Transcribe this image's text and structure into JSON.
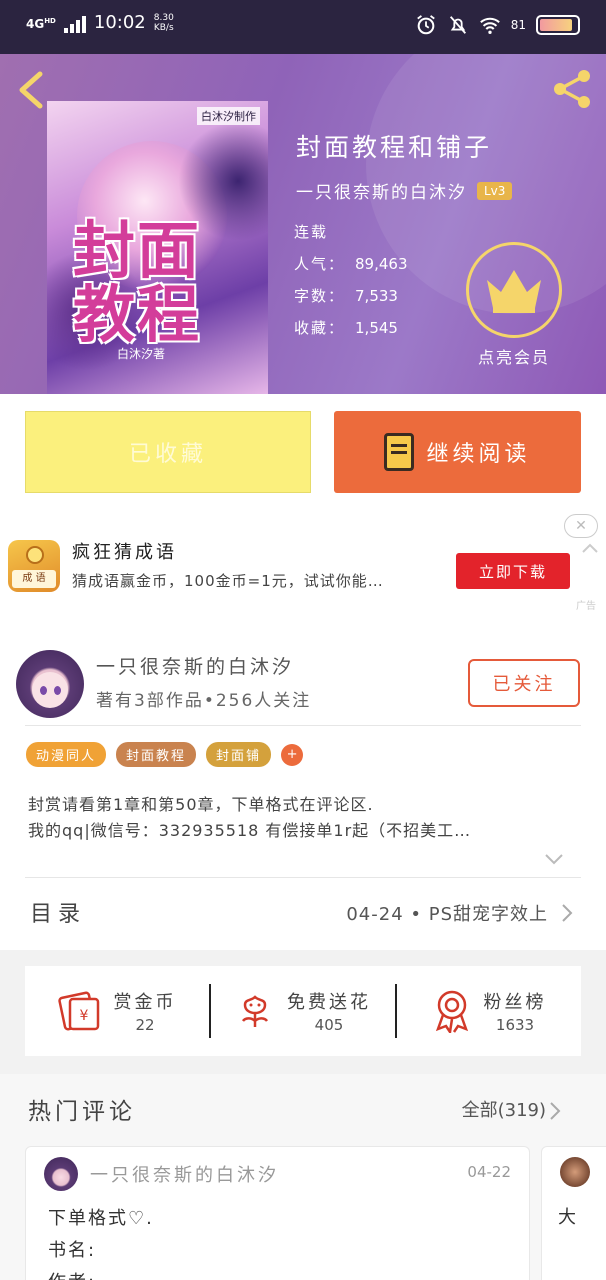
{
  "status_bar": {
    "network": "4G",
    "network_sup": "HD",
    "time": "10:02",
    "speed_value": "8.30",
    "speed_unit": "KB/s",
    "battery": "81"
  },
  "book": {
    "cover_badge": "白沐汐制作",
    "cover_title": "封面教程",
    "cover_author": "白沐汐著",
    "title": "封面教程和铺子",
    "author": "一只很奈斯的白沐汐",
    "level": "Lv3",
    "status": "连载",
    "stats": [
      {
        "label": "人气：",
        "value": "89,463"
      },
      {
        "label": "字数：",
        "value": "7,533"
      },
      {
        "label": "收藏：",
        "value": "1,545"
      }
    ],
    "vip_label": "点亮会员"
  },
  "actions": {
    "collected_label": "已收藏",
    "read_label": "继续阅读"
  },
  "ad": {
    "icon_text": "成 语",
    "title": "疯狂猜成语",
    "desc": "猜成语赢金币，100金币=1元，试试你能…",
    "button": "立即下载",
    "close": "✕",
    "tag": "广告"
  },
  "author_section": {
    "name": "一只很奈斯的白沐汐",
    "sub": "著有3部作品•256人关注",
    "follow_label": "已关注",
    "tags": [
      {
        "label": "动漫同人",
        "color": "#f0a236"
      },
      {
        "label": "封面教程",
        "color": "#c9834f"
      },
      {
        "label": "封面铺",
        "color": "#d4a13c"
      }
    ],
    "tag_plus": "+",
    "desc_lines": [
      "封赏请看第1章和第50章，下单格式在评论区.",
      "我的qq|微信号：332935518 有偿接单1r起（不招美工…"
    ]
  },
  "toc": {
    "label": "目录",
    "latest": "04-24 • PS甜宠字效上"
  },
  "gifts": [
    {
      "label": "赏金币",
      "count": "22",
      "icon": "red-envelope-icon"
    },
    {
      "label": "免费送花",
      "count": "405",
      "icon": "flower-icon"
    },
    {
      "label": "粉丝榜",
      "count": "1633",
      "icon": "medal-icon"
    }
  ],
  "hot_comments": {
    "title": "热门评论",
    "all_label": "全部(319)",
    "cards": [
      {
        "name": "一只很奈斯的白沐汐",
        "date": "04-22",
        "lines": [
          "下单格式♡.",
          "书名:",
          "作者:"
        ]
      },
      {
        "lines": [
          "大"
        ]
      }
    ]
  },
  "colors": {
    "accent": "#ec6b3c",
    "hero": "#9a6bbf",
    "collected": "#fbf07d",
    "ad_button": "#e3232b",
    "vip_gold": "#f5d56a"
  }
}
